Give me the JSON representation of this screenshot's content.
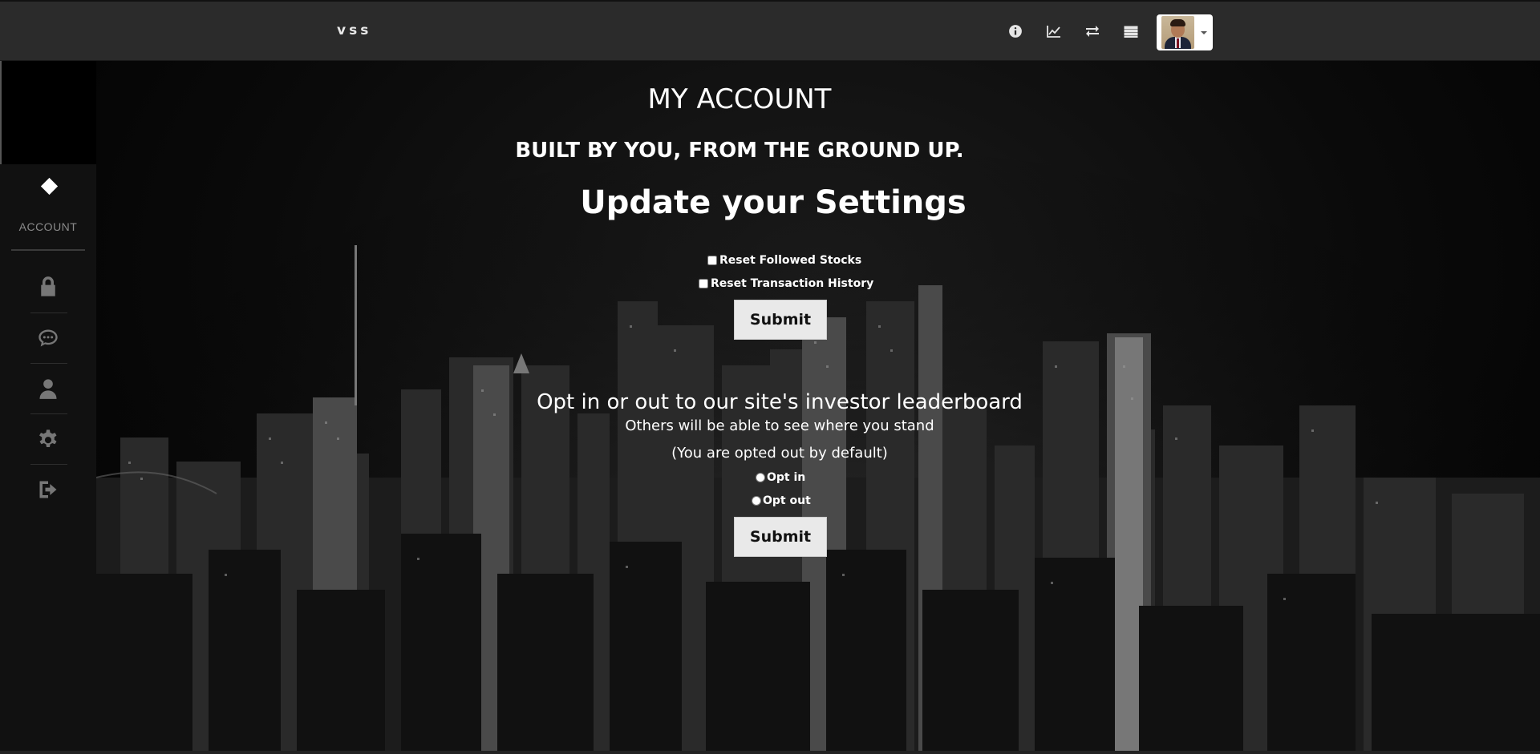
{
  "navbar": {
    "brand": "vss",
    "icons": [
      "info-icon",
      "line-chart-icon",
      "exchange-icon",
      "list-icon"
    ],
    "avatar": "user-avatar"
  },
  "sidebar": {
    "header_icon": "diamond-icon",
    "header_label": "ACCOUNT",
    "items": [
      "lock-icon",
      "chat-icon",
      "user-icon",
      "gear-icon",
      "sign-out-icon"
    ]
  },
  "main": {
    "title": "MY ACCOUNT",
    "tagline": "BUILT BY YOU, FROM THE GROUND UP.",
    "settings_heading": "Update your Settings",
    "checkboxes": [
      {
        "label": "Reset Followed Stocks",
        "checked": false
      },
      {
        "label": "Reset Transaction History",
        "checked": false
      }
    ],
    "submit_label": "Submit",
    "leaderboard": {
      "heading": "Opt in or out to our site's investor leaderboard",
      "description": "Others will be able to see where you stand",
      "note": "(You are opted out by default)",
      "options": [
        {
          "label": "Opt in",
          "selected": false
        },
        {
          "label": "Opt out",
          "selected": false
        }
      ],
      "submit_label": "Submit"
    }
  },
  "colors": {
    "navbar_bg": "#2b2b2b",
    "sidebar_bg": "#111111",
    "button_bg": "#e9e9e9",
    "text": "#ffffff"
  }
}
